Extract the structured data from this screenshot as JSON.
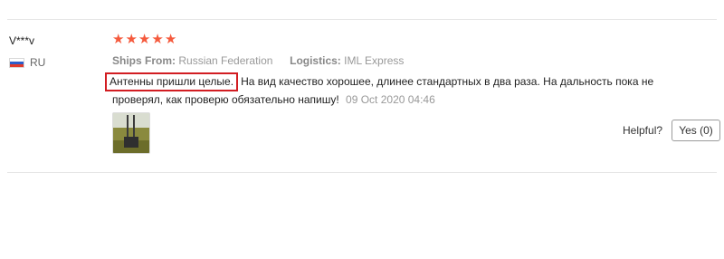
{
  "review": {
    "user_name": "V***v",
    "country_code": "RU",
    "rating_stars": 5,
    "ships_from_label": "Ships From:",
    "ships_from_value": "Russian Federation",
    "logistics_label": "Logistics:",
    "logistics_value": "IML Express",
    "text_highlighted": "Антенны пришли целые.",
    "text_line1_rest": "На вид качество хорошее, длинее стандартных в два раза. На дальность пока не",
    "text_line2": "проверял, как проверю обязательно напишу!",
    "date": "09 Oct 2020 04:46",
    "helpful_label": "Helpful?",
    "yes_button_label": "Yes (0)"
  },
  "colors": {
    "star": "#f55a3d",
    "highlight_border": "#d21d22",
    "divider": "#e6e6e6"
  },
  "icons": {
    "star": "star-icon",
    "flag": "russia-flag-icon"
  }
}
